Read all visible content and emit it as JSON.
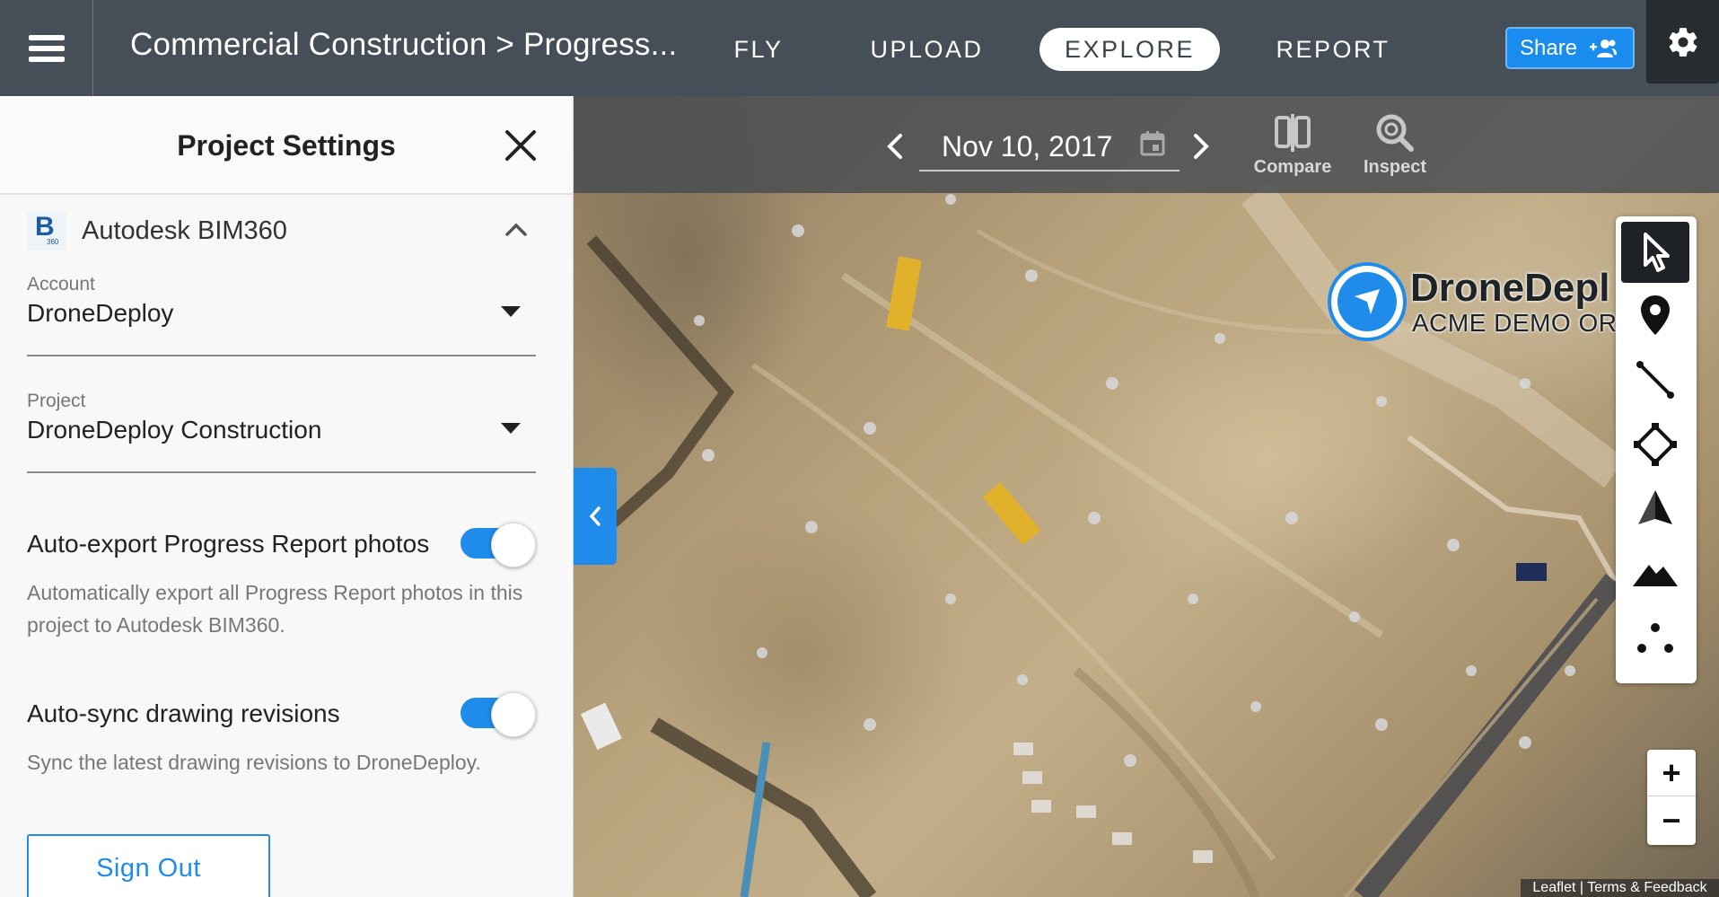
{
  "header": {
    "breadcrumb": "Commercial Construction > Progress...",
    "tabs": [
      {
        "label": "FLY"
      },
      {
        "label": "UPLOAD"
      },
      {
        "label": "EXPLORE",
        "active": true
      },
      {
        "label": "REPORT"
      }
    ],
    "share_label": "Share",
    "icons": {
      "menu": "hamburger-icon",
      "share": "add-people-icon",
      "settings": "gear-icon"
    }
  },
  "panel": {
    "title": "Project Settings",
    "integration": {
      "logo_letter": "B",
      "logo_sub": "360",
      "name": "Autodesk BIM360"
    },
    "account": {
      "label": "Account",
      "value": "DroneDeploy"
    },
    "project": {
      "label": "Project",
      "value": "DroneDeploy Construction"
    },
    "auto_export": {
      "title": "Auto-export Progress Report photos",
      "description": "Automatically export all Progress Report photos in this project to Autodesk BIM360.",
      "enabled": true
    },
    "auto_sync": {
      "title": "Auto-sync drawing revisions",
      "description": "Sync the latest drawing revisions to DroneDeploy.",
      "enabled": true
    },
    "sign_out_label": "Sign Out"
  },
  "map": {
    "date": "Nov 10, 2017",
    "compare_label": "Compare",
    "inspect_label": "Inspect",
    "logo_name": "DroneDepl",
    "logo_sub": "ACME DEMO ORG",
    "zoom_in": "+",
    "zoom_out": "−",
    "attribution_leaflet": "Leaflet",
    "attribution_sep": " | ",
    "attribution_terms": "Terms & Feedback",
    "tools": [
      "select-tool",
      "marker-tool",
      "line-tool",
      "area-tool",
      "volume-tool",
      "elevation-tool",
      "points-tool"
    ],
    "colors": {
      "accent": "#1f8bea",
      "nav": "#464e57"
    }
  }
}
